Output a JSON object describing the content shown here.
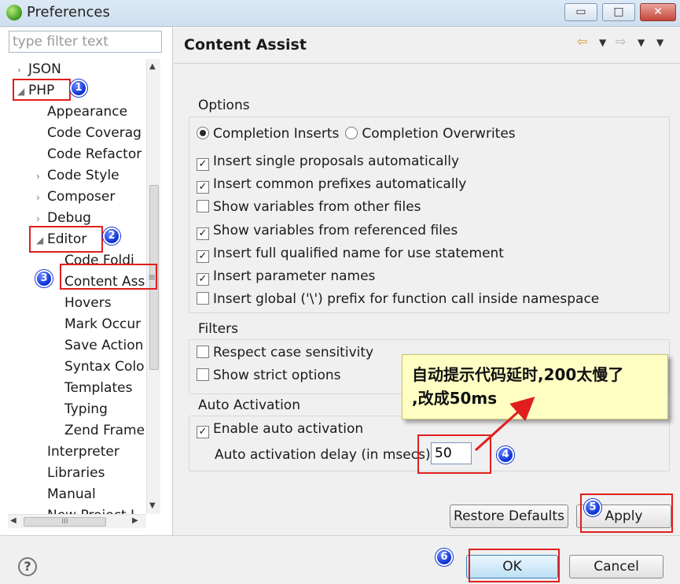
{
  "window": {
    "title": "Preferences",
    "controls": {
      "minimize": "▭",
      "maximize": "□",
      "close": "✕"
    }
  },
  "sidebar": {
    "filter_placeholder": "type filter text",
    "items": [
      {
        "label": "JSON",
        "level": 0,
        "twisty": "›"
      },
      {
        "label": "PHP",
        "level": 0,
        "twisty": "◢"
      },
      {
        "label": "Appearance",
        "level": 1,
        "twisty": ""
      },
      {
        "label": "Code Coverag",
        "level": 1,
        "twisty": ""
      },
      {
        "label": "Code Refactor",
        "level": 1,
        "twisty": ""
      },
      {
        "label": "Code Style",
        "level": 1,
        "twisty": "›"
      },
      {
        "label": "Composer",
        "level": 1,
        "twisty": "›"
      },
      {
        "label": "Debug",
        "level": 1,
        "twisty": "›"
      },
      {
        "label": "Editor",
        "level": 1,
        "twisty": "◢"
      },
      {
        "label": "Code Foldi",
        "level": 2,
        "twisty": ""
      },
      {
        "label": "Content Ass",
        "level": 2,
        "twisty": ""
      },
      {
        "label": "Hovers",
        "level": 2,
        "twisty": ""
      },
      {
        "label": "Mark Occur",
        "level": 2,
        "twisty": ""
      },
      {
        "label": "Save Action",
        "level": 2,
        "twisty": ""
      },
      {
        "label": "Syntax Colo",
        "level": 2,
        "twisty": ""
      },
      {
        "label": "Templates",
        "level": 2,
        "twisty": ""
      },
      {
        "label": "Typing",
        "level": 2,
        "twisty": ""
      },
      {
        "label": "Zend Frame",
        "level": 2,
        "twisty": ""
      },
      {
        "label": "Interpreter",
        "level": 1,
        "twisty": ""
      },
      {
        "label": "Libraries",
        "level": 1,
        "twisty": ""
      },
      {
        "label": "Manual",
        "level": 1,
        "twisty": ""
      },
      {
        "label": "New Project L",
        "level": 1,
        "twisty": ""
      }
    ],
    "hscroll_grip": "III",
    "vscroll_grip": "≡"
  },
  "page": {
    "title": "Content Assist",
    "nav": {
      "back": "⇦",
      "forward": "⇨",
      "dropdown": "▼",
      "menu": "▼"
    },
    "options": {
      "label": "Options",
      "radios": [
        {
          "label": "Completion Inserts",
          "selected": true
        },
        {
          "label": "Completion Overwrites",
          "selected": false
        }
      ],
      "checkboxes": [
        {
          "label": "Insert single proposals automatically",
          "checked": true
        },
        {
          "label": "Insert common prefixes automatically",
          "checked": true
        },
        {
          "label": "Show variables from other files",
          "checked": false
        },
        {
          "label": "Show variables from referenced files",
          "checked": true
        },
        {
          "label": "Insert full qualified name for use statement",
          "checked": true
        },
        {
          "label": "Insert parameter names",
          "checked": true
        },
        {
          "label": "Insert global ('\\') prefix for function call inside namespace",
          "checked": false
        }
      ]
    },
    "filters": {
      "label": "Filters",
      "checkboxes": [
        {
          "label": "Respect case sensitivity",
          "checked": false
        },
        {
          "label": "Show strict options",
          "checked": false
        }
      ]
    },
    "auto_activation": {
      "label": "Auto Activation",
      "enable_label": "Enable auto activation",
      "enable_checked": true,
      "delay_label": "Auto activation delay (in msecs)",
      "delay_value": "50"
    },
    "restore_defaults": "Restore Defaults",
    "apply": "Apply"
  },
  "footer": {
    "help": "?",
    "ok": "OK",
    "cancel": "Cancel"
  },
  "annotations": {
    "note_line1": "自动提示代码延时,200太慢了",
    "note_line2": ",改成50ms",
    "badges": [
      "1",
      "2",
      "3",
      "4",
      "5",
      "6"
    ],
    "color": "#e01e1e",
    "badge_color": "#0b2fd6"
  },
  "check_mark": "✓"
}
